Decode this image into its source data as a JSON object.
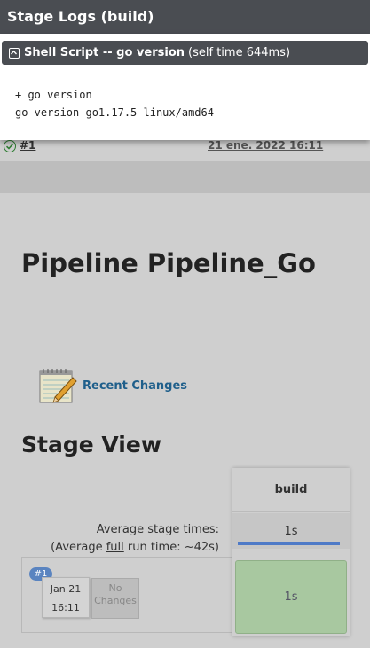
{
  "logs": {
    "title": "Stage Logs (build)",
    "step_name": "Shell Script -- go version",
    "step_time": "(self time 644ms)",
    "output_lines": [
      "+ go version",
      "go version go1.17.5 linux/amd64"
    ]
  },
  "background": {
    "build_link": "#1",
    "build_date": "21 ene. 2022 16:11",
    "pipeline_title": "Pipeline Pipeline_Go",
    "recent_changes": "Recent Changes",
    "stage_view_title": "Stage View"
  },
  "stage_view": {
    "average_label": "Average stage times:",
    "average_full_prefix": "(Average ",
    "average_full_word": "full",
    "average_full_suffix": " run time: ~42s)",
    "stage_name": "build",
    "stage_avg_time": "1s",
    "build_badge": "#1",
    "build_date_day": "Jan 21",
    "build_date_time": "16:11",
    "no_changes": "No Changes",
    "stage_cell_time": "1s"
  },
  "colors": {
    "header_bg": "#4a4d52",
    "success_cell": "#a8c8a0",
    "badge": "#5a84c0",
    "link": "#1f5f8b"
  }
}
